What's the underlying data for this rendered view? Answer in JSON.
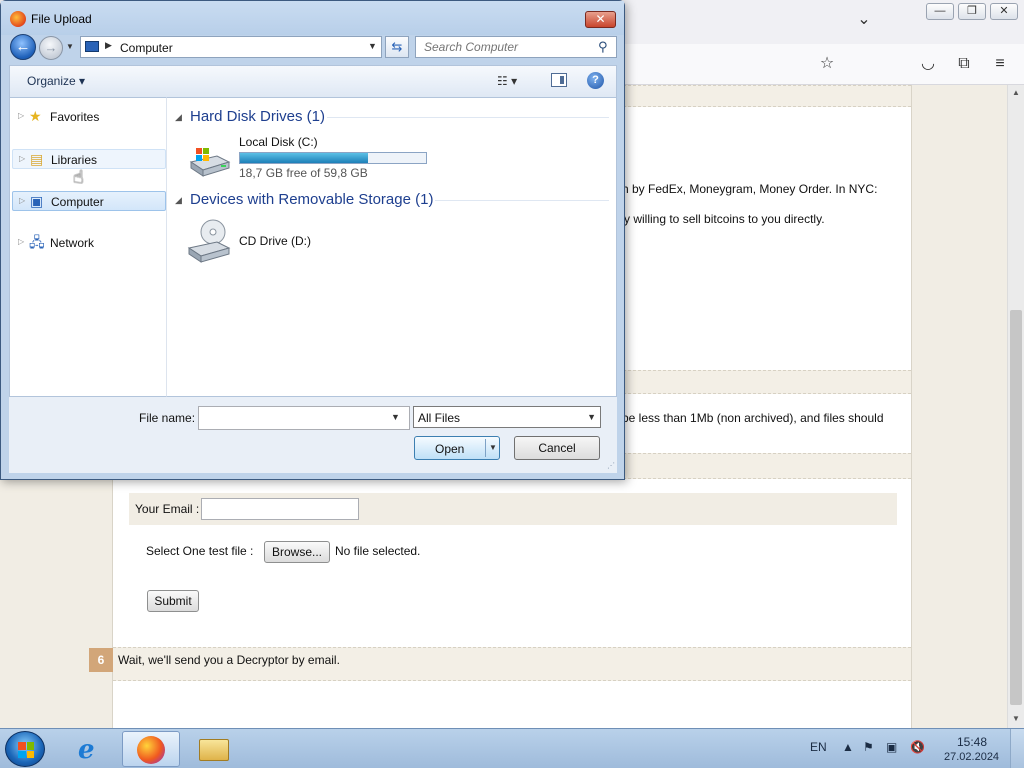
{
  "dialog": {
    "title": "File Upload",
    "close_label": "✕",
    "address": {
      "location": "Computer"
    },
    "search": {
      "placeholder": "Search Computer"
    },
    "toolbar": {
      "organize_label": "Organize ▾",
      "help_label": "?"
    },
    "nav_pane": {
      "items": [
        {
          "label": "Favorites",
          "icon": "star-icon"
        },
        {
          "label": "Libraries",
          "icon": "libraries-icon"
        },
        {
          "label": "Computer",
          "icon": "computer-icon"
        },
        {
          "label": "Network",
          "icon": "network-icon"
        }
      ]
    },
    "content": {
      "groups": [
        {
          "header": "Hard Disk Drives (1)"
        },
        {
          "header": "Devices with Removable Storage (1)"
        }
      ],
      "drives": [
        {
          "name": "Local Disk (C:)",
          "free_text": "18,7 GB free of 59,8 GB",
          "used_fraction": 0.687,
          "icon": "hard-disk-icon"
        },
        {
          "name": "CD Drive (D:)",
          "icon": "cd-drive-icon"
        }
      ]
    },
    "footer": {
      "file_name_label": "File name:",
      "file_name_value": "",
      "file_type_selected": "All Files",
      "open_label": "Open",
      "cancel_label": "Cancel"
    }
  },
  "page": {
    "text_line1_fragment": "h by FedEx, Moneygram, Money Order. In NYC:",
    "text_line2_fragment": "y willing to sell bitcoins to you directly.",
    "text_line3_fragment": "be less than 1Mb (non archived), and files should",
    "email_label": "Your Email :",
    "email_value": "",
    "file_label": "Select One test file :",
    "browse_label": "Browse...",
    "no_file_text": "No file selected.",
    "submit_label": "Submit",
    "step6_number": "6",
    "step6_text": "Wait, we'll send you a Decryptor by email."
  },
  "taskbar": {
    "apps": [
      {
        "name": "Internet Explorer",
        "icon": "ie-icon"
      },
      {
        "name": "Firefox",
        "icon": "firefox-icon",
        "active": true
      },
      {
        "name": "Windows Explorer",
        "icon": "explorer-icon"
      }
    ],
    "language": "EN",
    "time": "15:48",
    "date": "27.02.2024"
  },
  "colors": {
    "progress_fill": "#1d7fb8",
    "group_header": "#1e3f8f",
    "step_badge": "#d2a679"
  }
}
